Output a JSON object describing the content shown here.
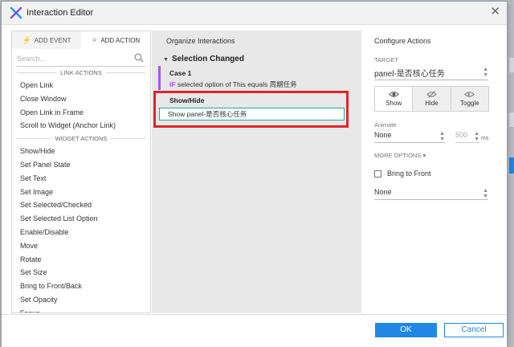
{
  "window": {
    "title": "Interaction Editor"
  },
  "left": {
    "tabs": [
      {
        "label": "ADD EVENT"
      },
      {
        "label": "ADD ACTION"
      }
    ],
    "search_placeholder": "Search...",
    "sections": [
      {
        "title": "LINK ACTIONS",
        "items": [
          "Open Link",
          "Close Window",
          "Open Link in Frame",
          "Scroll to Widget (Anchor Link)"
        ]
      },
      {
        "title": "WIDGET ACTIONS",
        "items": [
          "Show/Hide",
          "Set Panel State",
          "Set Text",
          "Set Image",
          "Set Selected/Checked",
          "Set Selected List Option",
          "Enable/Disable",
          "Move",
          "Rotate",
          "Set Size",
          "Bring to Front/Back",
          "Set Opacity",
          "Focus"
        ]
      }
    ]
  },
  "middle": {
    "title": "Organize Interactions",
    "event": "Selection Changed",
    "case": {
      "name": "Case 1",
      "cond_if": "IF",
      "cond_text": "selected option of This equals 周期任务"
    },
    "action": {
      "name": "Show/Hide",
      "detail": "Show panel-是否核心任务"
    }
  },
  "right": {
    "title": "Configure Actions",
    "target_label": "TARGET",
    "target_value": "panel-是否核心任务",
    "buttons": [
      {
        "label": "Show"
      },
      {
        "label": "Hide"
      },
      {
        "label": "Toggle"
      }
    ],
    "animate_label": "Animate",
    "animate_value": "None",
    "duration": "500",
    "duration_unit": "ms",
    "more_options": "MORE OPTIONS ▾",
    "bring_front": "Bring to Front",
    "bring_front_value": "None"
  },
  "footer": {
    "ok": "OK",
    "cancel": "Cancel"
  },
  "colors": {
    "accent": "#1f88e5",
    "case_bar": "#a855f7",
    "highlight": "#e0242b",
    "selected_border": "#26a69a"
  }
}
